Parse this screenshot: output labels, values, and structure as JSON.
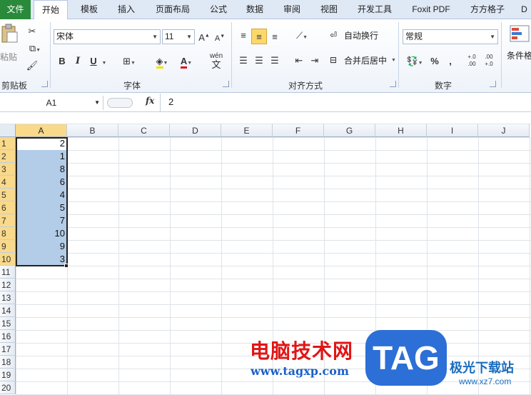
{
  "tabs": [
    {
      "label": "文件"
    },
    {
      "label": "开始"
    },
    {
      "label": "模板"
    },
    {
      "label": "插入"
    },
    {
      "label": "页面布局"
    },
    {
      "label": "公式"
    },
    {
      "label": "数据"
    },
    {
      "label": "审阅"
    },
    {
      "label": "视图"
    },
    {
      "label": "开发工具"
    },
    {
      "label": "Foxit PDF"
    },
    {
      "label": "方方格子"
    },
    {
      "label": "D"
    }
  ],
  "ribbon": {
    "clipboard": {
      "paste_label": "粘贴",
      "group_label": "剪贴板"
    },
    "font": {
      "font_name": "宋体",
      "font_size": "11",
      "group_label": "字体",
      "bold": "B",
      "italic": "I",
      "underline": "U",
      "phonetic": "wén"
    },
    "alignment": {
      "wrap_label": "自动换行",
      "merge_label": "合并后居中",
      "group_label": "对齐方式"
    },
    "number": {
      "format": "常规",
      "percent": "%",
      "comma": ",",
      "inc_decimal": "+.0 .00",
      "dec_decimal": ".00 +.0",
      "group_label": "数字"
    },
    "styles": {
      "conditional_label": "条件格"
    }
  },
  "formula_bar": {
    "name_box": "A1",
    "fx": "fx",
    "value": "2"
  },
  "sheet": {
    "columns": [
      "A",
      "B",
      "C",
      "D",
      "E",
      "F",
      "G",
      "H",
      "I",
      "J"
    ],
    "rows": [
      "1",
      "2",
      "3",
      "4",
      "5",
      "6",
      "7",
      "8",
      "9",
      "10",
      "11",
      "12",
      "13",
      "14",
      "15",
      "16",
      "17",
      "18",
      "19",
      "20"
    ],
    "column_a_values": [
      "2",
      "1",
      "8",
      "6",
      "4",
      "5",
      "7",
      "10",
      "9",
      "3"
    ]
  },
  "watermark": {
    "site_cn": "电脑技术网",
    "site_url": "www.tagxp.com",
    "tag": "TAG",
    "jg": "极光下载站",
    "jg_url": "www.xz7.com"
  },
  "colors": {
    "file_tab": "#2a8a3c",
    "selection": "#b3cde8",
    "header_selected": "#f9d98a",
    "watermark_red": "#e01515",
    "watermark_blue": "#2c6fd6"
  }
}
